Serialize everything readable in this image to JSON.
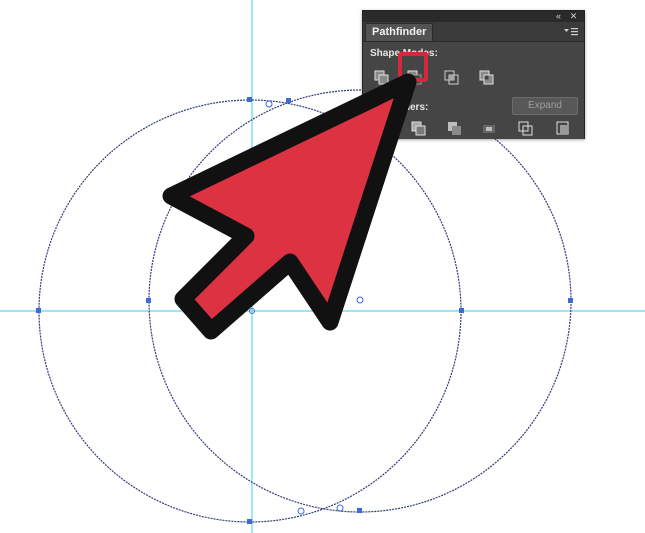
{
  "canvas": {
    "guide_color": "#5fd6ef",
    "path_color": "#2f3d7a",
    "circle_left_name": "circle-left",
    "circle_right_name": "circle-right"
  },
  "pathfinder": {
    "tab_title": "Pathfinder",
    "collapse_icon": "double-chevron-left-icon",
    "close_icon": "close-icon",
    "menu_icon": "panel-menu-icon",
    "shape_modes_label": "Shape Modes:",
    "pathfinders_label": "Pathfinders:",
    "expand_label": "Expand",
    "shape_modes": [
      {
        "name": "unite",
        "icon": "unite-icon"
      },
      {
        "name": "minus-front",
        "icon": "minus-front-icon",
        "highlighted": true
      },
      {
        "name": "intersect",
        "icon": "intersect-icon"
      },
      {
        "name": "exclude",
        "icon": "exclude-icon"
      }
    ],
    "pathfinders": [
      {
        "name": "divide",
        "icon": "divide-icon"
      },
      {
        "name": "trim",
        "icon": "trim-icon"
      },
      {
        "name": "merge",
        "icon": "merge-icon"
      },
      {
        "name": "crop",
        "icon": "crop-icon"
      },
      {
        "name": "outline",
        "icon": "outline-icon"
      },
      {
        "name": "minus-back",
        "icon": "minus-back-icon"
      }
    ],
    "highlight_color": "#d6283d"
  },
  "pointer": {
    "icon": "cursor-arrow-icon",
    "fill": "#dd3242",
    "stroke": "#111111"
  }
}
